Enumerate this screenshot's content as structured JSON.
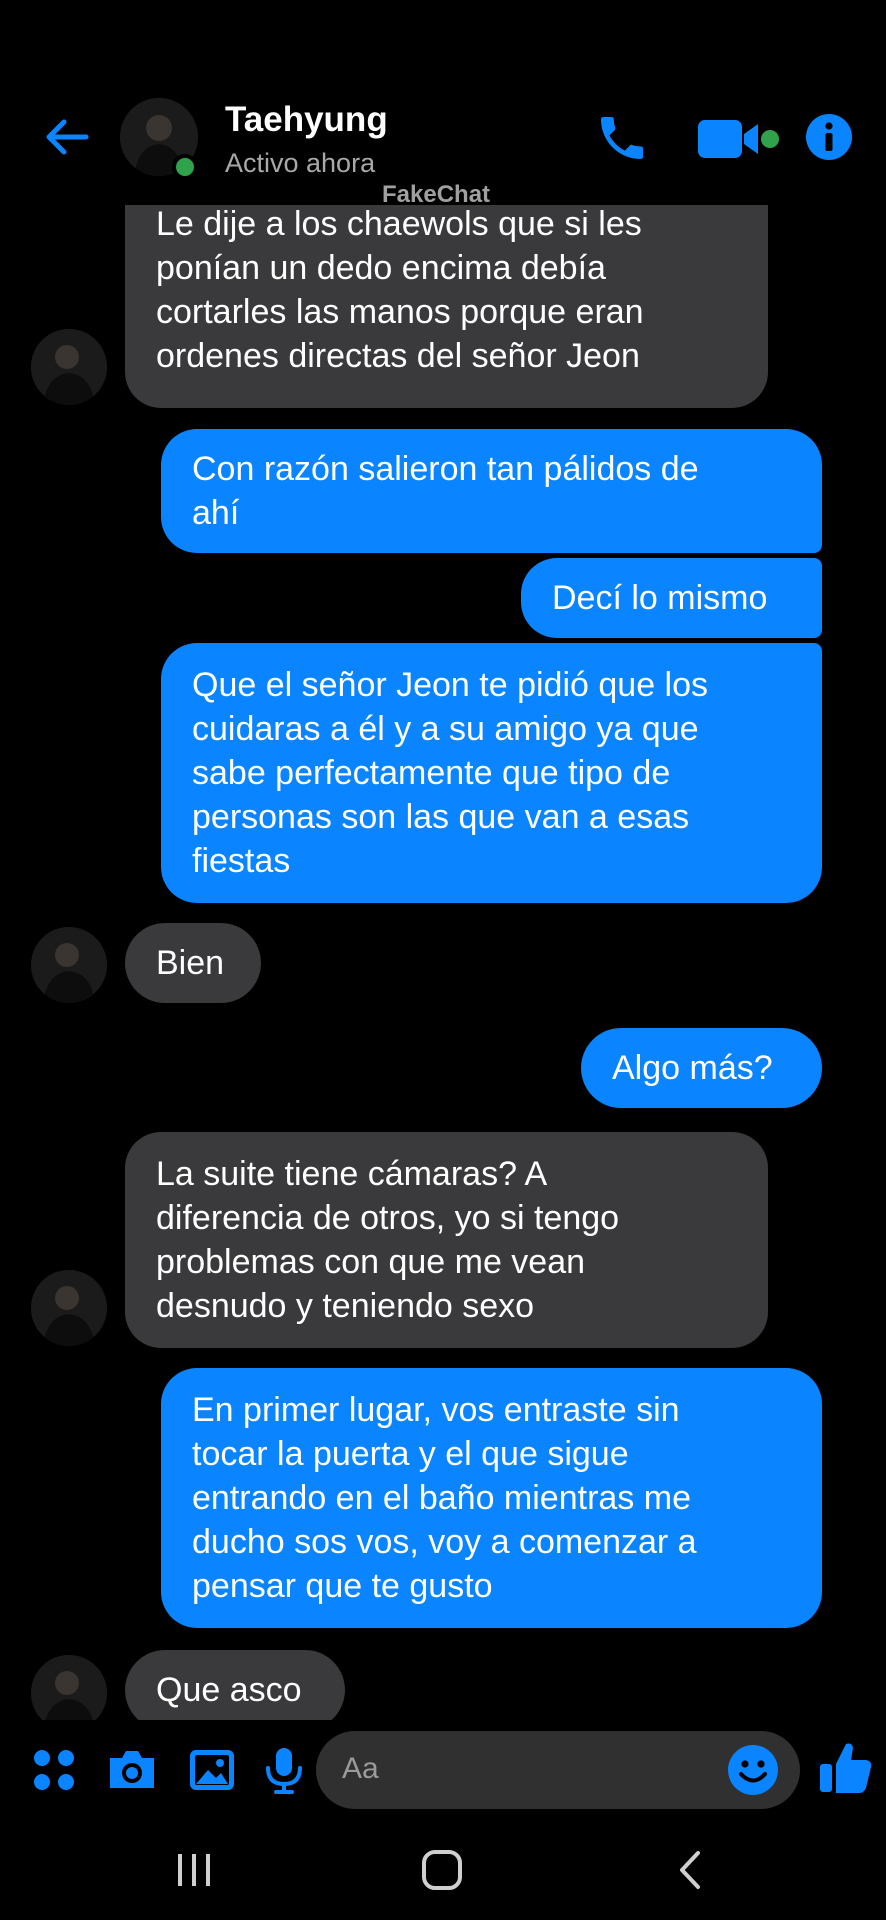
{
  "header": {
    "contact_name": "Taehyung",
    "status": "Activo ahora",
    "watermark": "FakeChat"
  },
  "messages": [
    {
      "side": "in",
      "text": "Le dije a los chaewols que si les\nponían un dedo encima debía\ncortarles las manos porque eran\nordenes directas del señor Jeon"
    },
    {
      "side": "out",
      "text": "Con razón salieron tan pálidos de\nahí"
    },
    {
      "side": "out",
      "text": "Decí lo mismo"
    },
    {
      "side": "out",
      "text": "Que el señor Jeon te pidió que los\ncuidaras a él y a su amigo ya que\nsabe perfectamente que tipo de\npersonas son las que van a esas\nfiestas"
    },
    {
      "side": "in",
      "text": "Bien"
    },
    {
      "side": "out",
      "text": "Algo más?"
    },
    {
      "side": "in",
      "text": "La suite tiene cámaras? A\ndiferencia de otros, yo si tengo\nproblemas con que me vean\ndesnudo y teniendo sexo"
    },
    {
      "side": "out",
      "text": "En primer lugar, vos entraste sin\ntocar la puerta y el que sigue\nentrando en el baño mientras me\nducho sos vos, voy a comenzar a\npensar que te gusto"
    },
    {
      "side": "in",
      "text": "Que asco"
    }
  ],
  "composer": {
    "placeholder": "Aa",
    "icons": [
      "apps-icon",
      "camera-icon",
      "image-icon",
      "microphone-icon",
      "emoji-icon",
      "thumbs-up-icon"
    ]
  },
  "navbar": {
    "icons": [
      "recent-apps-icon",
      "home-icon",
      "back-icon"
    ]
  },
  "colors": {
    "accent": "#0a84ff",
    "incoming_bubble": "#3a3a3c",
    "background": "#000000",
    "online": "#31a24c"
  }
}
